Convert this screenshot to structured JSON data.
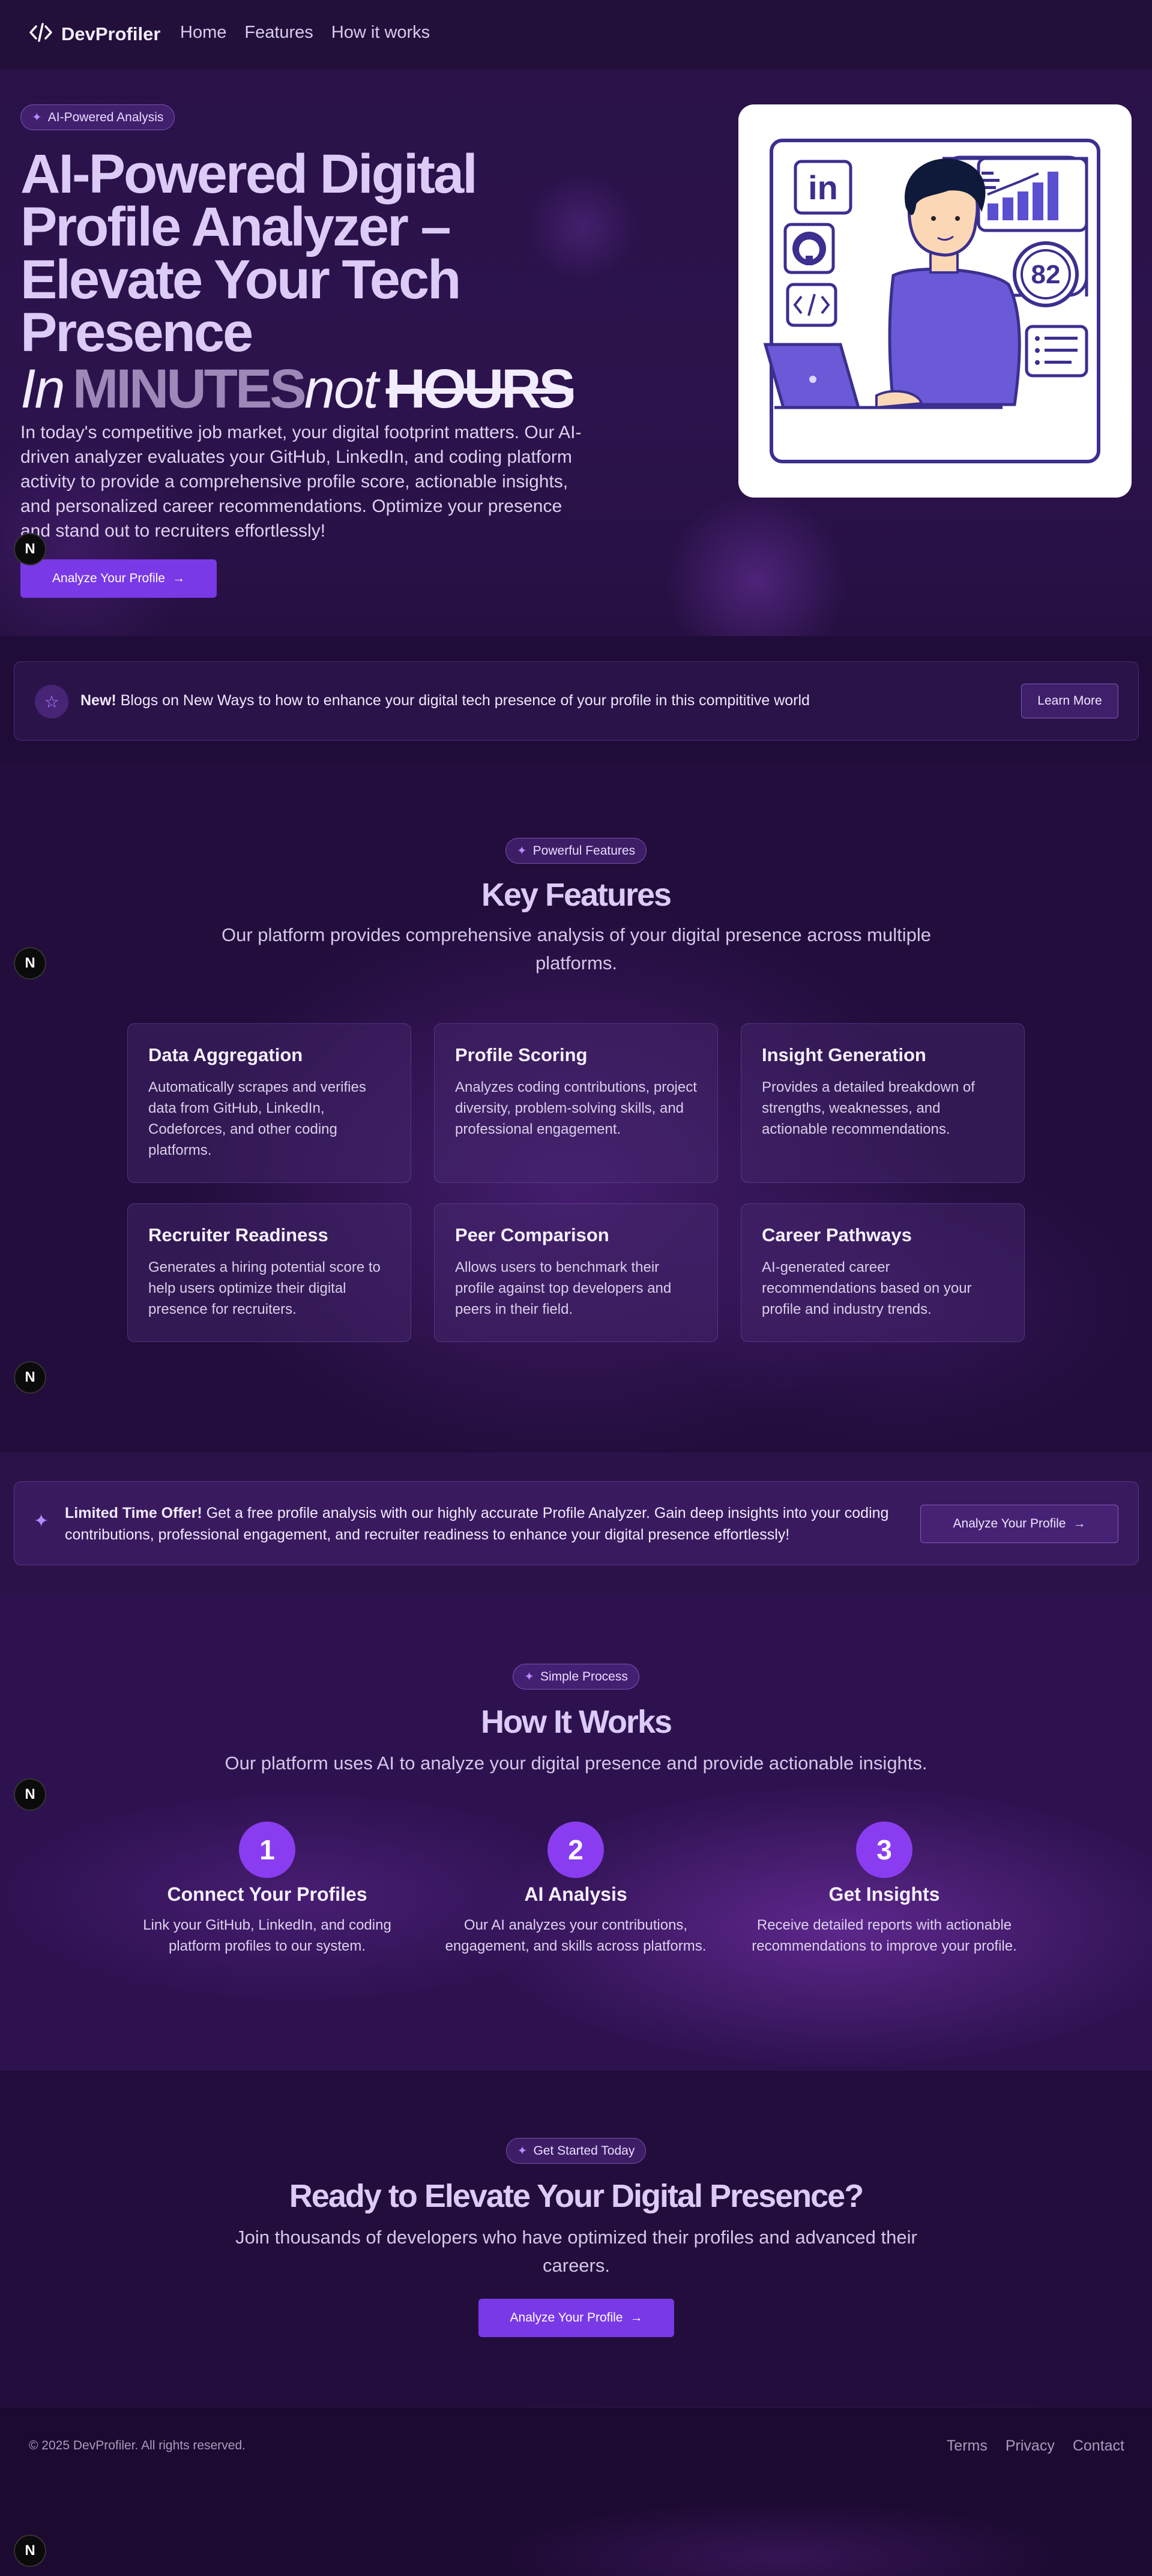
{
  "nav": {
    "brand": "DevProfiler",
    "links": [
      "Home",
      "Features",
      "How it works"
    ]
  },
  "hero": {
    "badge": "AI-Powered Analysis",
    "title": "AI-Powered Digital Profile Analyzer – Elevate Your Tech Presence",
    "tag_in": "In",
    "tag_minutes": "MINUTES",
    "tag_not": "not",
    "tag_hours": "HOURS",
    "description": "In today's competitive job market, your digital footprint matters. Our AI-driven analyzer evaluates your GitHub, LinkedIn, and coding platform activity to provide a comprehensive profile score, actionable insights, and personalized career recommendations. Optimize your presence and stand out to recruiters effortlessly!",
    "cta": "Analyze Your Profile",
    "score": "82",
    "linkedin_label": "in"
  },
  "news": {
    "new_label": "New!",
    "text": "Blogs on New Ways to how to enhance your digital tech presence of your profile in this compititive world",
    "button": "Learn More"
  },
  "features": {
    "badge": "Powerful Features",
    "title": "Key Features",
    "subtitle": "Our platform provides comprehensive analysis of your digital presence across multiple platforms.",
    "cards": [
      {
        "title": "Data Aggregation",
        "desc": "Automatically scrapes and verifies data from GitHub, LinkedIn, Codeforces, and other coding platforms."
      },
      {
        "title": "Profile Scoring",
        "desc": "Analyzes coding contributions, project diversity, problem-solving skills, and professional engagement."
      },
      {
        "title": "Insight Generation",
        "desc": "Provides a detailed breakdown of strengths, weaknesses, and actionable recommendations."
      },
      {
        "title": "Recruiter Readiness",
        "desc": "Generates a hiring potential score to help users optimize their digital presence for recruiters."
      },
      {
        "title": "Peer Comparison",
        "desc": "Allows users to benchmark their profile against top developers and peers in their field."
      },
      {
        "title": "Career Pathways",
        "desc": "AI-generated career recommendations based on your profile and industry trends."
      }
    ]
  },
  "offer": {
    "label": "Limited Time Offer!",
    "text": "Get a free profile analysis with our highly accurate Profile Analyzer. Gain deep insights into your coding contributions, professional engagement, and recruiter readiness to enhance your digital presence effortlessly!",
    "button": "Analyze Your Profile"
  },
  "how": {
    "badge": "Simple Process",
    "title": "How It Works",
    "subtitle": "Our platform uses AI to analyze your digital presence and provide actionable insights.",
    "steps": [
      {
        "num": "1",
        "title": "Connect Your Profiles",
        "desc": "Link your GitHub, LinkedIn, and coding platform profiles to our system."
      },
      {
        "num": "2",
        "title": "AI Analysis",
        "desc": "Our AI analyzes your contributions, engagement, and skills across platforms."
      },
      {
        "num": "3",
        "title": "Get Insights",
        "desc": "Receive detailed reports with actionable recommendations to improve your profile."
      }
    ]
  },
  "cta": {
    "badge": "Get Started Today",
    "title": "Ready to Elevate Your Digital Presence?",
    "subtitle": "Join thousands of developers who have optimized their profiles and advanced their careers.",
    "button": "Analyze Your Profile"
  },
  "footer": {
    "copyright": "© 2025 DevProfiler. All rights reserved.",
    "links": [
      "Terms",
      "Privacy",
      "Contact"
    ]
  },
  "floating_badge": "N",
  "colors": {
    "accent": "#7a39e6",
    "step": "#8a3df0",
    "illustration_stroke": "#3b2f8f",
    "illustration_fill": "#6a5ad8"
  }
}
